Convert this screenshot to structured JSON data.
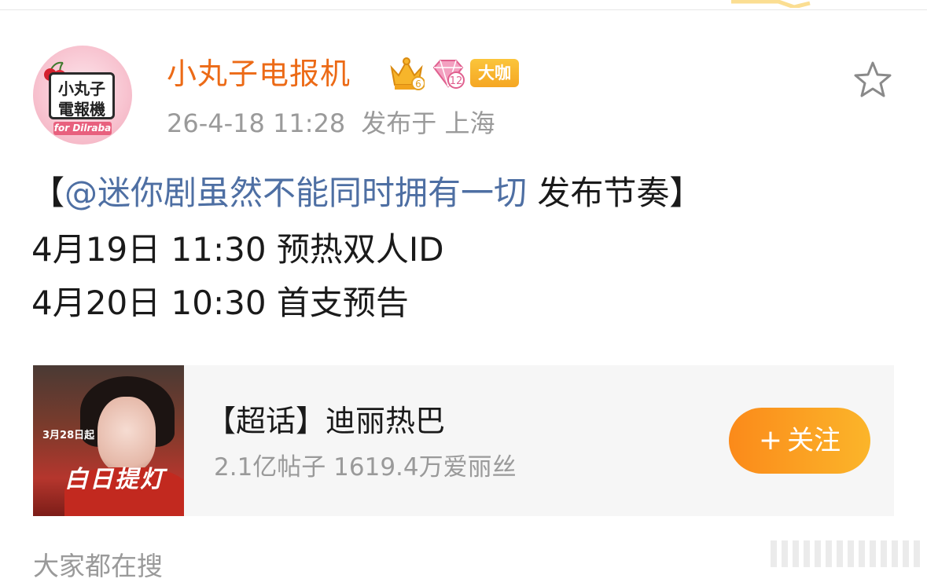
{
  "post": {
    "avatar": {
      "line1": "小丸子",
      "line2": "電報機",
      "tag": "for Dilraba"
    },
    "username": "小丸子电报机",
    "crown_level": "6",
    "diamond_level": "12",
    "vip_badge": "大咖",
    "date": "26-4-18 11:28",
    "location": "发布于 上海",
    "content": {
      "bracket_open": "【",
      "mention": "@迷你剧虽然不能同时拥有一切",
      "title_rest": " 发布节奏】",
      "line2": "4月19日 11:30  预热双人ID",
      "line3": "4月20日 10:30  首支预告"
    }
  },
  "topic_card": {
    "thumbnail": {
      "date_text": "3月28日起",
      "title_text": "白日提灯"
    },
    "title": "【超话】迪丽热巴",
    "stats": "2.1亿帖子 1619.4万爱丽丝",
    "follow_plus": "+",
    "follow_label": "关注"
  },
  "footer": {
    "search_label": "大家都在搜"
  },
  "colors": {
    "username": "#ec6a16",
    "mention": "#4e6fa3",
    "follow_button": "#fb9a1f",
    "meta_text": "#9a9a9a"
  },
  "icons": [
    "star-icon",
    "crown-icon",
    "diamond-icon",
    "cherry-icon"
  ]
}
